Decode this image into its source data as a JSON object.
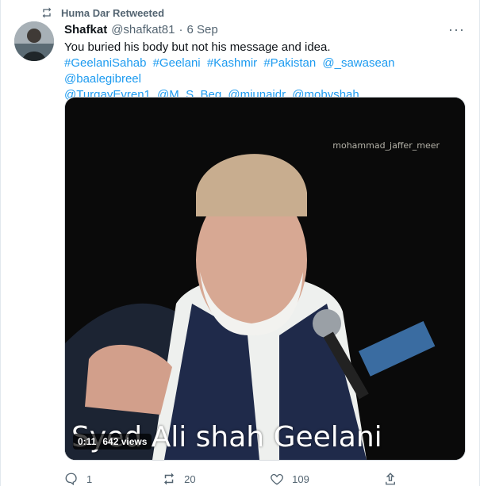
{
  "retweet": {
    "text": "Huma Dar Retweeted"
  },
  "tweet": {
    "author_name": "Shafkat",
    "handle": "@shafkat81",
    "separator": "·",
    "time": "6 Sep",
    "body": "You buried his body but not his message and idea.",
    "tags": [
      "#GeelaniSahab",
      "#Geelani",
      "#Kashmir",
      "#Pakistan",
      "@_sawasean",
      "@baalegibreel",
      "@TurgayEvren1",
      "@M_S_Beg",
      "@mjunaidr",
      "@mobyshah"
    ],
    "more": "···"
  },
  "media": {
    "watermark": "mohammad_jaffer_meer",
    "caption": "Syed Ali shah Geelani",
    "duration": "0:11",
    "views": "642 views"
  },
  "actions": {
    "reply_count": "1",
    "retweet_count": "20",
    "like_count": "109"
  },
  "colors": {
    "link": "#1d9bf0",
    "muted": "#536471",
    "text": "#0f1419"
  }
}
